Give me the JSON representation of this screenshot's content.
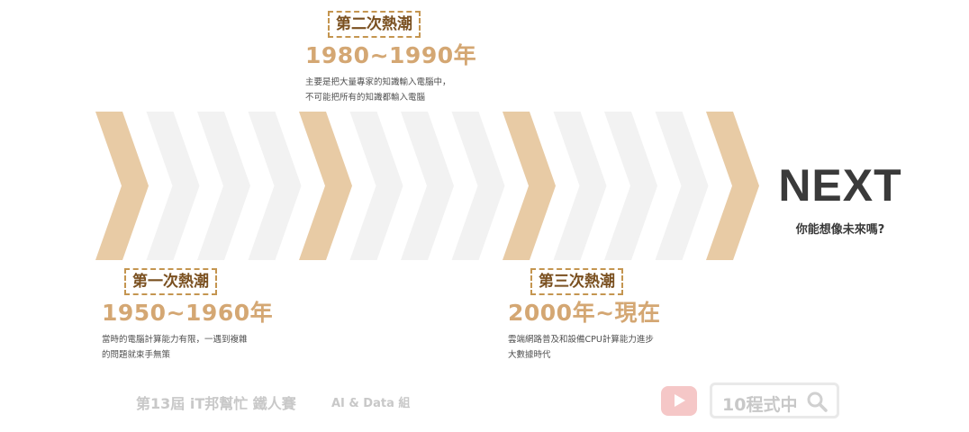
{
  "colors": {
    "accent": "#e8cba5",
    "pale": "#f2f2f2",
    "label_border": "#c49550",
    "years": "#d4a773",
    "next": "#3a3a3a"
  },
  "eras": [
    {
      "label": "第一次熱潮",
      "years": "1950~1960年",
      "desc_line1": "當時的電腦計算能力有限，一遇到複雜",
      "desc_line2": "的問題就束手無策"
    },
    {
      "label": "第二次熱潮",
      "years": "1980~1990年",
      "desc_line1": "主要是把大量專家的知識輸入電腦中，",
      "desc_line2": "不可能把所有的知識都輸入電腦"
    },
    {
      "label": "第三次熱潮",
      "years": "2000年~現在",
      "desc_line1": "雲端網路普及和設備CPU計算能力進步",
      "desc_line2": "大數據時代"
    }
  ],
  "next": {
    "title": "NEXT",
    "subtitle": "你能想像未來嗎?"
  },
  "footer": {
    "contest": "第13屆 iT邦幫忙 鐵人賽",
    "category": "AI & Data 組",
    "search_text": "10程式中",
    "icons": {
      "video": "play-icon",
      "search": "search-icon"
    }
  }
}
